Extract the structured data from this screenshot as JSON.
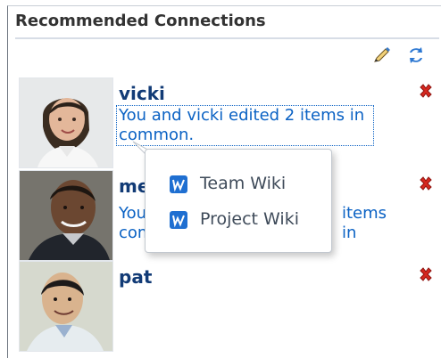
{
  "header": {
    "title": "Recommended Connections"
  },
  "toolbar": {
    "edit_icon": "pencil-icon",
    "refresh_icon": "refresh-icon"
  },
  "connections": [
    {
      "name": "vicki",
      "detail": "You and vicki edited 2 items in common."
    },
    {
      "name": "me",
      "detail_lines": [
        "You",
        "items in",
        "com"
      ]
    },
    {
      "name": "pat"
    }
  ],
  "popup": {
    "items": [
      {
        "label": "Team Wiki",
        "icon": "wiki-icon"
      },
      {
        "label": "Project Wiki",
        "icon": "wiki-icon"
      }
    ]
  },
  "colors": {
    "name": "#123b76",
    "link": "#0b62c4",
    "remove": "#d6281f"
  }
}
